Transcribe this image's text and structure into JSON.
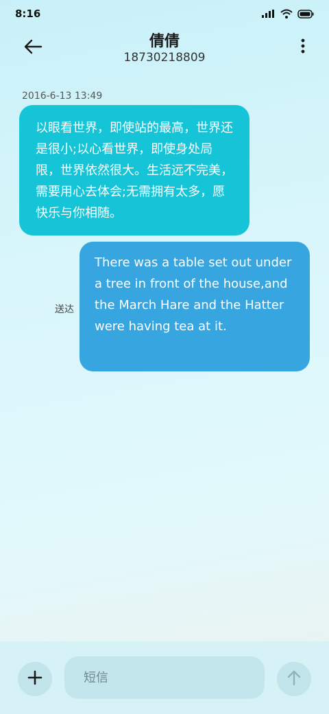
{
  "status_bar": {
    "time": "8:16",
    "icons": [
      "signal-icon",
      "wifi-icon",
      "battery-icon"
    ]
  },
  "header": {
    "contact_name": "倩倩",
    "phone_number": "18730218809",
    "back_icon": "arrow-left-icon",
    "more_icon": "more-vertical-icon"
  },
  "conversation": {
    "timestamp": "2016-6-13 13:49",
    "incoming_message": "以眼看世界，即使站的最高，世界还是很小;以心看世界，即使身处局限，世界依然很大。生活远不完美，需要用心去体会;无需拥有太多，愿快乐与你相随。",
    "outgoing_message": "There was a table set out under a tree in front of the house,and the March Hare and the Hatter were having tea at it.",
    "delivered_label": "送达"
  },
  "composer": {
    "placeholder": "短信",
    "value": "",
    "add_icon": "plus-icon",
    "send_icon": "arrow-up-icon"
  },
  "colors": {
    "incoming_bubble": "#16c4d8",
    "outgoing_bubble": "#36a5e0",
    "bottom_bar": "#d6f2f6"
  }
}
